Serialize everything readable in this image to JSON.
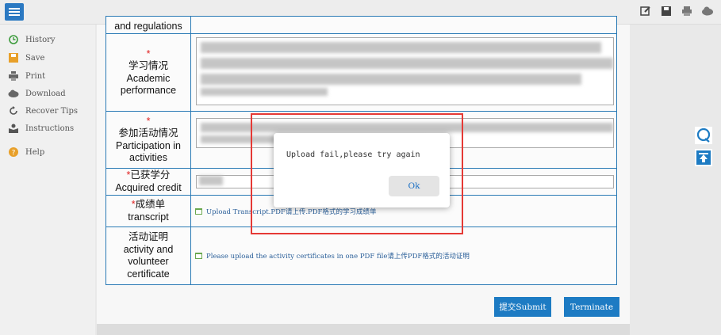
{
  "sidebar": {
    "items": [
      {
        "label": "History",
        "icon": "history-icon"
      },
      {
        "label": "Save",
        "icon": "save-icon"
      },
      {
        "label": "Print",
        "icon": "print-icon"
      },
      {
        "label": "Download",
        "icon": "download-icon"
      },
      {
        "label": "Recover Tips",
        "icon": "recover-icon"
      },
      {
        "label": "Instructions",
        "icon": "instructions-icon"
      },
      {
        "label": "Help",
        "icon": "help-icon"
      }
    ]
  },
  "toolbar": {
    "icons": [
      "edit-icon",
      "save-icon",
      "print-icon",
      "cloud-icon"
    ]
  },
  "form": {
    "row0": {
      "label": "and regulations"
    },
    "row1": {
      "star": "*",
      "label_cn": "学习情况",
      "label_en1": "Academic",
      "label_en2": "performance"
    },
    "row2": {
      "star": "*",
      "label_cn": "参加活动情况",
      "label_en1": "Participation in",
      "label_en2": "activities"
    },
    "row3": {
      "star": "*",
      "label_cn": "已获学分",
      "label_en1": "Acquired credit"
    },
    "row4": {
      "star": "*",
      "label_cn": "成绩单",
      "label_en1": "transcript",
      "upload": "Upload Transcript.PDF请上传.PDF格式的学习成绩单"
    },
    "row5": {
      "label_cn": "活动证明",
      "label_en1": "activity and",
      "label_en2": "volunteer",
      "label_en3": "certificate",
      "upload": "Please upload the activity certificates in one PDF file请上传PDF格式的活动证明"
    }
  },
  "actions": {
    "submit": "提交Submit",
    "terminate": "Terminate"
  },
  "dialog": {
    "message": "Upload fail,please try again",
    "ok": "Ok"
  },
  "colors": {
    "accent": "#1d7bc3",
    "border": "#2a7ab5",
    "highlight": "#e53935"
  }
}
